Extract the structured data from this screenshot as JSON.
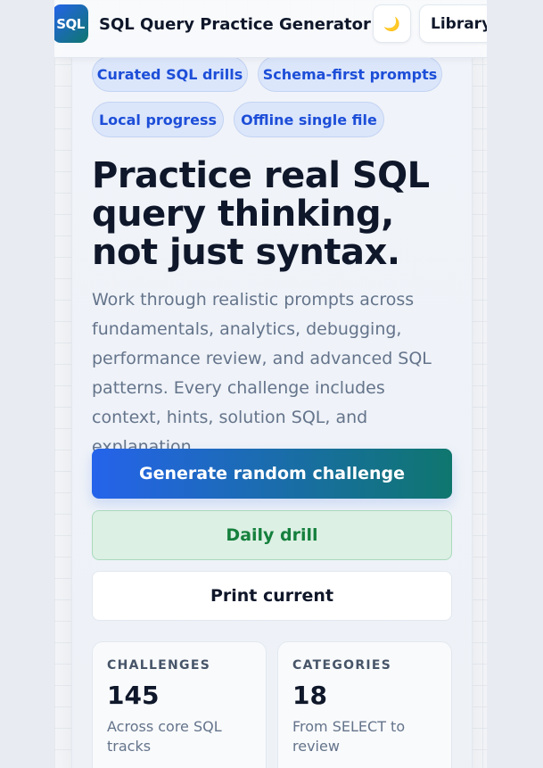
{
  "app": {
    "logo_text": "SQL",
    "title": "SQL Query Practice Generator",
    "theme_icon": "🌙",
    "library_label": "Library"
  },
  "chips": [
    "Curated SQL drills",
    "Schema-first prompts",
    "Local progress",
    "Offline single file"
  ],
  "hero": {
    "headline": "Practice real SQL query thinking, not just syntax.",
    "lede": "Work through realistic prompts across fundamentals, analytics, debugging, performance review, and advanced SQL patterns. Every challenge includes context, hints, solution SQL, and explanation."
  },
  "actions": {
    "generate": "Generate random challenge",
    "daily": "Daily drill",
    "print": "Print current"
  },
  "stats": [
    {
      "label": "CHALLENGES",
      "value": "145",
      "note": "Across core SQL tracks"
    },
    {
      "label": "CATEGORIES",
      "value": "18",
      "note": "From SELECT to review"
    }
  ],
  "colors": {
    "accent_blue": "#2563eb",
    "accent_teal": "#0f766e",
    "chip_text": "#1d4ed8",
    "daily_green": "#15803d"
  }
}
